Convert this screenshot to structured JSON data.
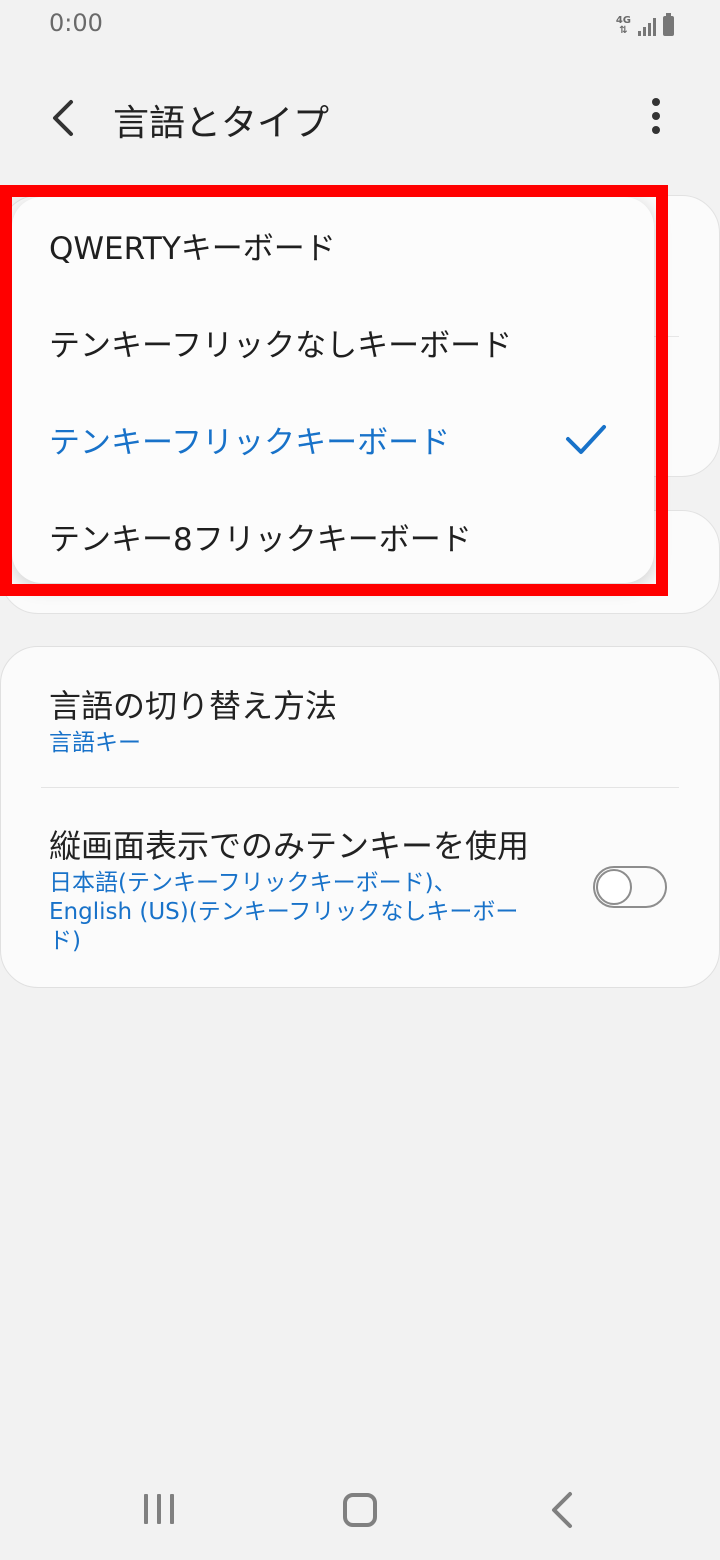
{
  "status_bar": {
    "time": "0:00",
    "network": "4G",
    "icons": [
      "4g-icon",
      "signal-icon",
      "battery-icon"
    ]
  },
  "app_bar": {
    "title": "言語とタイプ",
    "back_icon": "chevron-left-icon",
    "more_icon": "more-vert-icon"
  },
  "keyboard_menu": {
    "options": [
      {
        "label": "QWERTYキーボード",
        "selected": false
      },
      {
        "label": "テンキーフリックなしキーボード",
        "selected": false
      },
      {
        "label": "テンキーフリックキーボード",
        "selected": true
      },
      {
        "label": "テンキー8フリックキーボード",
        "selected": false
      }
    ],
    "selected_icon": "check-icon"
  },
  "settings": {
    "switch_method": {
      "title": "言語の切り替え方法",
      "value": "言語キー"
    },
    "portrait_tenkey": {
      "title": "縦画面表示でのみテンキーを使用",
      "summary_line1": "日本語(テンキーフリックキーボード)、",
      "summary_line2": "English (US)(テンキーフリックなしキーボー",
      "summary_line3": "ド)",
      "enabled": false
    }
  },
  "colors": {
    "accent": "#1872c9",
    "highlight": "#ff0000",
    "background": "#f2f2f2"
  },
  "nav_bar": {
    "icons": [
      "recents-icon",
      "home-icon",
      "back-icon"
    ]
  }
}
